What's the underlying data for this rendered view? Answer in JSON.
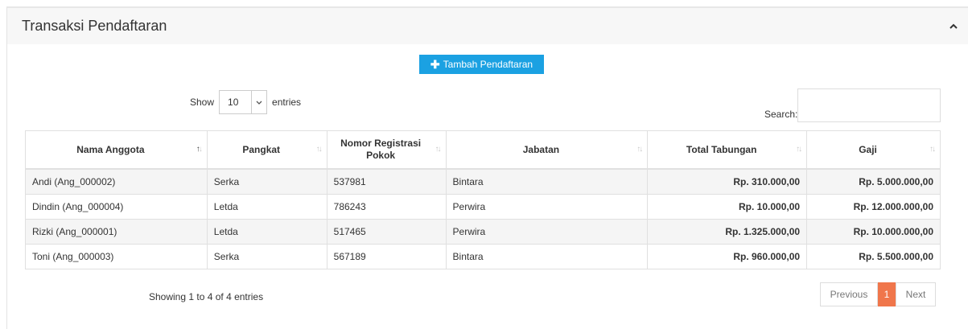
{
  "panel": {
    "title": "Transaksi Pendaftaran"
  },
  "add_button": {
    "label": "Tambah Pendaftaran"
  },
  "length": {
    "prefix": "Show",
    "value": "10",
    "suffix": "entries"
  },
  "search": {
    "label": "Search:",
    "value": ""
  },
  "table": {
    "headers": [
      {
        "label": "Nama Anggota",
        "sort": "asc"
      },
      {
        "label": "Pangkat",
        "sort": "none"
      },
      {
        "label": "Nomor Registrasi Pokok",
        "sort": "none"
      },
      {
        "label": "Jabatan",
        "sort": "none"
      },
      {
        "label": "Total Tabungan",
        "sort": "none"
      },
      {
        "label": "Gaji",
        "sort": "none"
      }
    ],
    "rows": [
      [
        "Andi (Ang_000002)",
        "Serka",
        "537981",
        "Bintara",
        "Rp. 310.000,00",
        "Rp. 5.000.000,00"
      ],
      [
        "Dindin (Ang_000004)",
        "Letda",
        "786243",
        "Perwira",
        "Rp. 10.000,00",
        "Rp. 12.000.000,00"
      ],
      [
        "Rizki (Ang_000001)",
        "Letda",
        "517465",
        "Perwira",
        "Rp. 1.325.000,00",
        "Rp. 10.000.000,00"
      ],
      [
        "Toni (Ang_000003)",
        "Serka",
        "567189",
        "Bintara",
        "Rp. 960.000,00",
        "Rp. 5.500.000,00"
      ]
    ]
  },
  "info": "Showing 1 to 4 of 4 entries",
  "pagination": {
    "previous": "Previous",
    "current": "1",
    "next": "Next"
  },
  "colors": {
    "accent": "#1ba1e2",
    "active_page": "#f0764b"
  }
}
